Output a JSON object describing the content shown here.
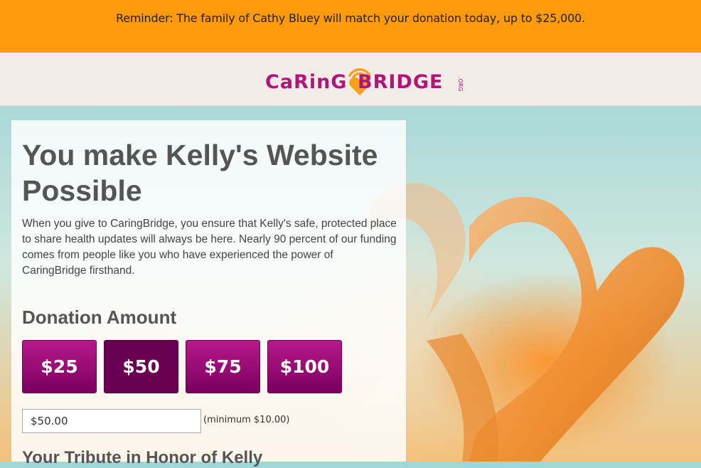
{
  "banner": {
    "text": "Reminder: The family of Cathy Bluey will match your donation today, up to $25,000."
  },
  "logo": {
    "left": "CaRinG",
    "right": "BRIDGE",
    "suffix": ".ORG"
  },
  "main": {
    "title": "You make Kelly's Website Possible",
    "intro": "When you give to CaringBridge, you ensure that Kelly's safe, protected place to share health updates will always be here. Nearly 90 percent of our funding comes from people like you who have experienced the power of CaringBridge firsthand.",
    "donation_heading": "Donation Amount",
    "amounts": [
      "$25",
      "$50",
      "$75",
      "$100"
    ],
    "selected_amount": "$50",
    "amount_value": "$50.00",
    "minimum_note": "(minimum $10.00)",
    "tribute_heading": "Your Tribute in Honor of Kelly"
  },
  "colors": {
    "banner": "#ff9a0c",
    "brand": "#b0157a",
    "button": "#8e0a6c",
    "button_selected": "#6a0051"
  }
}
